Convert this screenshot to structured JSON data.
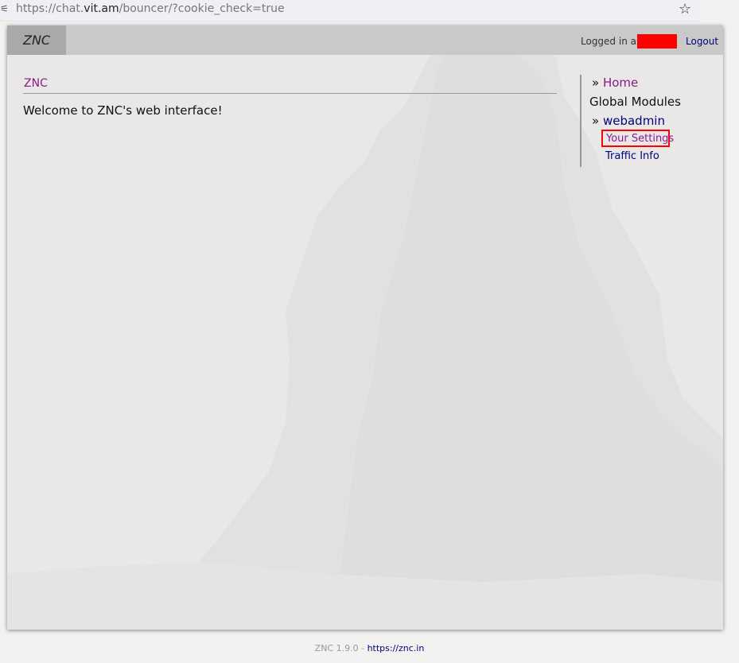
{
  "browser": {
    "url_prefix": "https://chat.",
    "url_host": "vit.am",
    "url_rest": "/bouncer/?cookie_check=true"
  },
  "header": {
    "brand": "ZNC",
    "logged_in_label": "Logged in as:",
    "logout_label": "Logout"
  },
  "main": {
    "title": "ZNC",
    "welcome": "Welcome to ZNC's web interface!"
  },
  "sidebar": {
    "bullet": "»",
    "home_label": "Home",
    "global_modules_label": "Global Modules",
    "webadmin_label": "webadmin",
    "sub_items": [
      {
        "label": "Your Settings"
      },
      {
        "label": "Traffic Info"
      }
    ]
  },
  "footer": {
    "version": "ZNC 1.9.0 - ",
    "link": "https://znc.in"
  },
  "colors": {
    "visited_link": "#8b1a8b",
    "link": "#000080",
    "highlight_box": "#ff0000",
    "redaction": "#ff0000"
  }
}
